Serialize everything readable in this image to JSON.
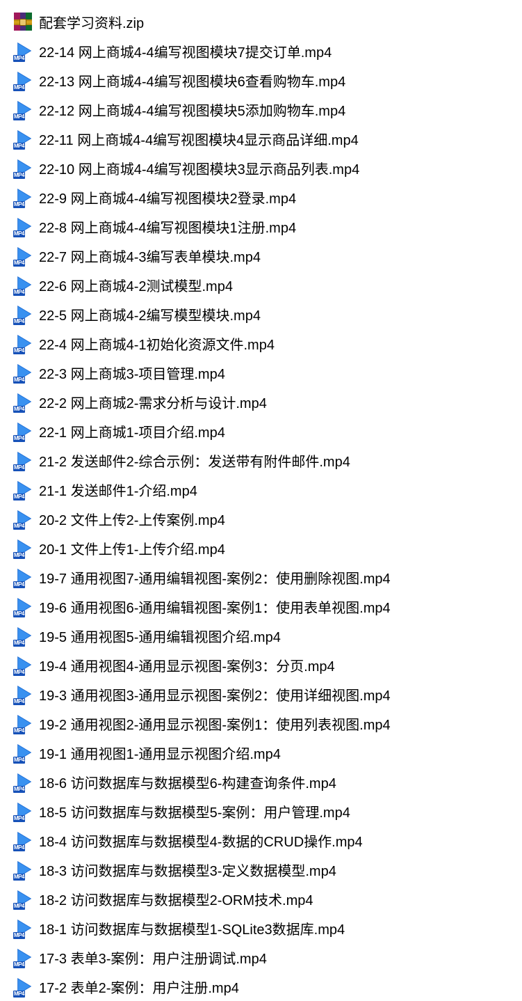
{
  "icons": {
    "zip": "zip-archive-icon",
    "mp4": "mp4-video-icon",
    "mp4_badge": "MP4"
  },
  "files": [
    {
      "type": "zip",
      "name": "配套学习资料.zip"
    },
    {
      "type": "mp4",
      "name": "22-14 网上商城4-4编写视图模块7提交订单.mp4"
    },
    {
      "type": "mp4",
      "name": "22-13 网上商城4-4编写视图模块6查看购物车.mp4"
    },
    {
      "type": "mp4",
      "name": "22-12 网上商城4-4编写视图模块5添加购物车.mp4"
    },
    {
      "type": "mp4",
      "name": "22-11 网上商城4-4编写视图模块4显示商品详细.mp4"
    },
    {
      "type": "mp4",
      "name": "22-10 网上商城4-4编写视图模块3显示商品列表.mp4"
    },
    {
      "type": "mp4",
      "name": "22-9 网上商城4-4编写视图模块2登录.mp4"
    },
    {
      "type": "mp4",
      "name": "22-8 网上商城4-4编写视图模块1注册.mp4"
    },
    {
      "type": "mp4",
      "name": "22-7 网上商城4-3编写表单模块.mp4"
    },
    {
      "type": "mp4",
      "name": "22-6 网上商城4-2测试模型.mp4"
    },
    {
      "type": "mp4",
      "name": "22-5 网上商城4-2编写模型模块.mp4"
    },
    {
      "type": "mp4",
      "name": "22-4 网上商城4-1初始化资源文件.mp4"
    },
    {
      "type": "mp4",
      "name": "22-3 网上商城3-项目管理.mp4"
    },
    {
      "type": "mp4",
      "name": "22-2 网上商城2-需求分析与设计.mp4"
    },
    {
      "type": "mp4",
      "name": "22-1 网上商城1-项目介绍.mp4"
    },
    {
      "type": "mp4",
      "name": "21-2 发送邮件2-综合示例：发送带有附件邮件.mp4"
    },
    {
      "type": "mp4",
      "name": "21-1 发送邮件1-介绍.mp4"
    },
    {
      "type": "mp4",
      "name": "20-2 文件上传2-上传案例.mp4"
    },
    {
      "type": "mp4",
      "name": "20-1 文件上传1-上传介绍.mp4"
    },
    {
      "type": "mp4",
      "name": "19-7 通用视图7-通用编辑视图-案例2：使用删除视图.mp4"
    },
    {
      "type": "mp4",
      "name": "19-6 通用视图6-通用编辑视图-案例1：使用表单视图.mp4"
    },
    {
      "type": "mp4",
      "name": "19-5 通用视图5-通用编辑视图介绍.mp4"
    },
    {
      "type": "mp4",
      "name": "19-4 通用视图4-通用显示视图-案例3：分页.mp4"
    },
    {
      "type": "mp4",
      "name": "19-3 通用视图3-通用显示视图-案例2：使用详细视图.mp4"
    },
    {
      "type": "mp4",
      "name": "19-2 通用视图2-通用显示视图-案例1：使用列表视图.mp4"
    },
    {
      "type": "mp4",
      "name": "19-1 通用视图1-通用显示视图介绍.mp4"
    },
    {
      "type": "mp4",
      "name": "18-6 访问数据库与数据模型6-构建查询条件.mp4"
    },
    {
      "type": "mp4",
      "name": "18-5 访问数据库与数据模型5-案例：用户管理.mp4"
    },
    {
      "type": "mp4",
      "name": "18-4 访问数据库与数据模型4-数据的CRUD操作.mp4"
    },
    {
      "type": "mp4",
      "name": "18-3 访问数据库与数据模型3-定义数据模型.mp4"
    },
    {
      "type": "mp4",
      "name": "18-2 访问数据库与数据模型2-ORM技术.mp4"
    },
    {
      "type": "mp4",
      "name": "18-1 访问数据库与数据模型1-SQLite3数据库.mp4"
    },
    {
      "type": "mp4",
      "name": "17-3 表单3-案例：用户注册调试.mp4"
    },
    {
      "type": "mp4",
      "name": "17-2 表单2-案例：用户注册.mp4"
    }
  ]
}
